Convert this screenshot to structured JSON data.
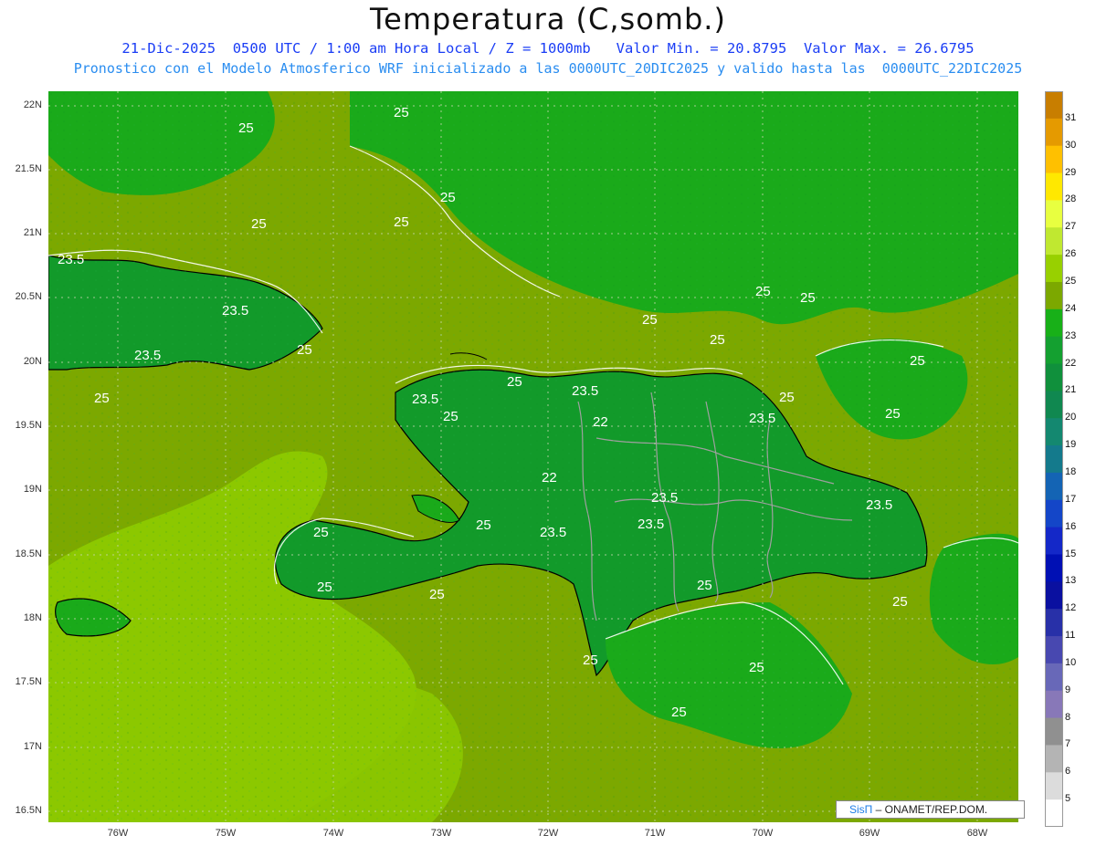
{
  "header": {
    "title": "Temperatura (C,somb.)",
    "line1": "21-Dic-2025  0500 UTC / 1:00 am Hora Local / Z = 1000mb   Valor Min. = 20.8795  Valor Max. = 26.6795",
    "line2": "Pronostico con el Modelo Atmosferico WRF inicializado a las 0000UTC_20DIC2025 y valido hasta las  0000UTC_22DIC2025"
  },
  "axes": {
    "lat_labels": [
      "22N",
      "21.5N",
      "21N",
      "20.5N",
      "20N",
      "19.5N",
      "19N",
      "18.5N",
      "18N",
      "17.5N",
      "17N",
      "16.5N"
    ],
    "lon_labels": [
      "76W",
      "75W",
      "74W",
      "73W",
      "72W",
      "71W",
      "70W",
      "69W",
      "68W"
    ]
  },
  "contour_labels": [
    "25",
    "25",
    "25",
    "25",
    "23.5",
    "25",
    "23.5",
    "23.5",
    "25",
    "25",
    "25",
    "25",
    "25",
    "25",
    "23.5",
    "25",
    "23.5",
    "25",
    "25",
    "22",
    "22",
    "23.5",
    "23.5",
    "23.5",
    "23.5",
    "25",
    "25",
    "23.5",
    "25",
    "25",
    "25",
    "25",
    "25",
    "25",
    "25",
    "25",
    "25"
  ],
  "colorbar": {
    "labels": [
      "31",
      "30",
      "29",
      "28",
      "27",
      "26",
      "25",
      "24",
      "23",
      "22",
      "21",
      "20",
      "19",
      "18",
      "17",
      "16",
      "15",
      "13",
      "12",
      "11",
      "10",
      "9",
      "8",
      "7",
      "6",
      "5"
    ],
    "colors": [
      "#c87e00",
      "#e59a00",
      "#ffc000",
      "#ffe800",
      "#e8ff40",
      "#c0e830",
      "#98d000",
      "#7ca800",
      "#18b018",
      "#14a030",
      "#10903c",
      "#108850",
      "#148870",
      "#147a8c",
      "#1464b4",
      "#1446c8",
      "#1428c8",
      "#0010b4",
      "#0a10a0",
      "#2830a8",
      "#4848b0",
      "#6868b8",
      "#8878b8",
      "#909090",
      "#b4b4b4",
      "#dcdcdc",
      "#ffffff"
    ]
  },
  "credit": {
    "brand": "SisΠ",
    "text": " – ONAMET/REP.DOM."
  },
  "palette": {
    "land_dark": "#129a2a",
    "land_mid": "#1aaa1a",
    "sea_olive": "#7ca800",
    "sea_light": "#8cc800",
    "title_blue": "#1a3df5",
    "subtitle_blue": "#2a8df0"
  }
}
